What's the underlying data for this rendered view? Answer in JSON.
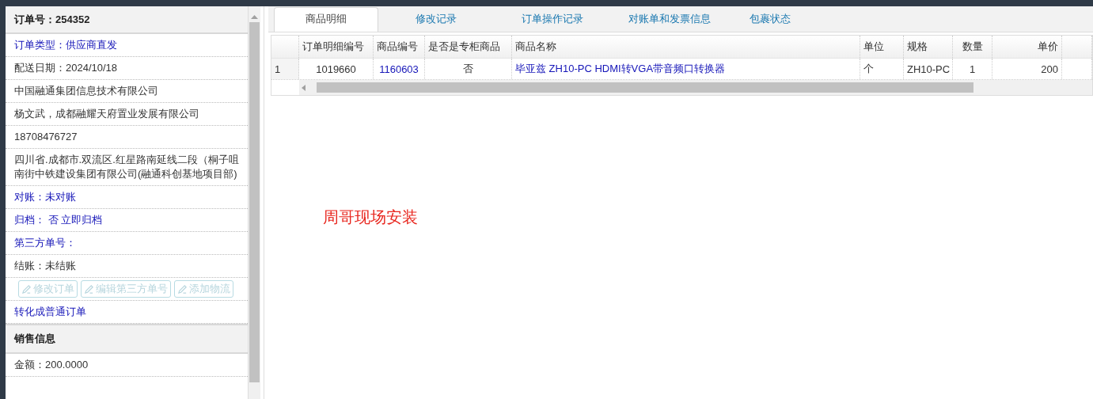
{
  "order_panel": {
    "header": "订单号：254352",
    "rows": [
      {
        "kind": "link",
        "text": "订单类型：供应商直发"
      },
      {
        "kind": "text",
        "text": "配送日期：2024/10/18"
      },
      {
        "kind": "text",
        "text": "中国融通集团信息技术有限公司"
      },
      {
        "kind": "text",
        "text": "杨文武，成都融耀天府置业发展有限公司"
      },
      {
        "kind": "text",
        "text": "18708476727"
      },
      {
        "kind": "text",
        "text": "四川省.成都市.双流区.红星路南延线二段（桐子咀南街中铁建设集团有限公司(融通科创基地项目部)"
      },
      {
        "kind": "link",
        "text": "对账：未对账"
      },
      {
        "kind": "link",
        "text": "归档：  否 立即归档"
      },
      {
        "kind": "link",
        "text": "第三方单号："
      },
      {
        "kind": "text",
        "text": "结账：未结账"
      }
    ],
    "buttons": [
      {
        "label": "修改订单",
        "disabled": true
      },
      {
        "label": "编辑第三方单号",
        "disabled": true
      },
      {
        "label": "添加物流",
        "disabled": true
      }
    ],
    "convert_link": "转化成普通订单",
    "sales_header": "销售信息",
    "amount": "金额：200.0000"
  },
  "tabs": [
    {
      "label": "商品明细",
      "selected": true
    },
    {
      "label": "修改记录",
      "selected": false
    },
    {
      "label": "订单操作记录",
      "selected": false
    },
    {
      "label": "对账单和发票信息",
      "selected": false
    },
    {
      "label": "包裹状态",
      "selected": false
    }
  ],
  "table": {
    "columns": [
      "订单明细编号",
      "商品编号",
      "是否是专柜商品",
      "商品名称",
      "单位",
      "规格",
      "数量",
      "单价"
    ],
    "rows": [
      {
        "index": "1",
        "cells": [
          "1019660",
          "1160603",
          "否",
          "毕亚兹 ZH10-PC HDMI转VGA带音频口转换器",
          "个",
          "ZH10-PC",
          "1",
          "200"
        ]
      }
    ]
  },
  "note": "周哥现场安装"
}
